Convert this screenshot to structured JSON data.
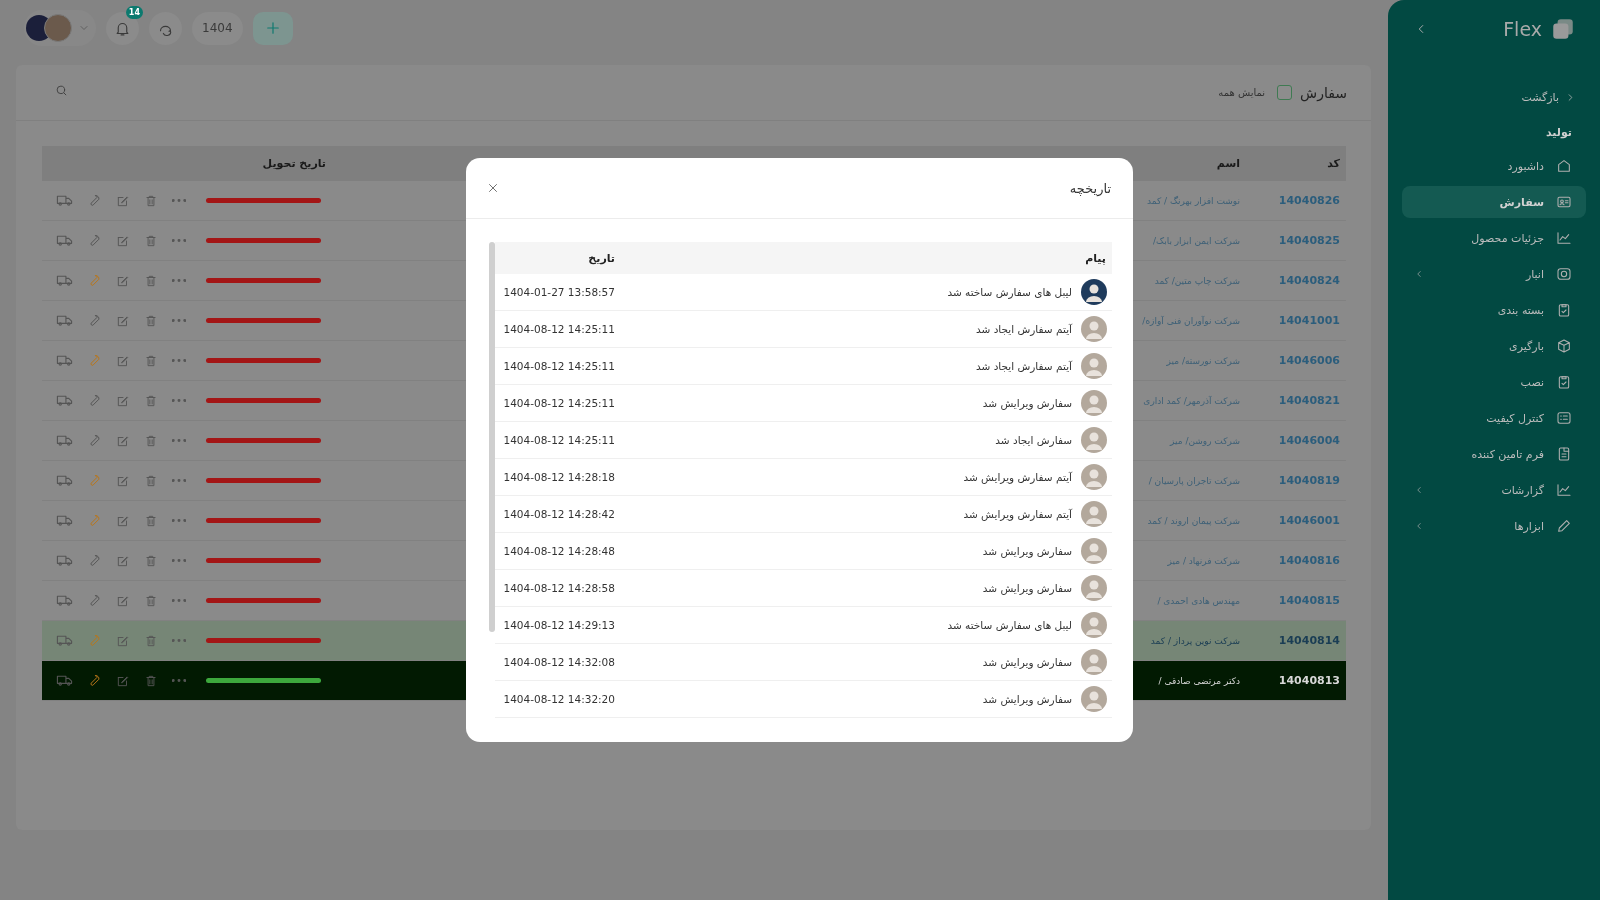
{
  "top_bar": {
    "notifications_badge": "14",
    "year": "1404"
  },
  "page": {
    "title": "سفارش",
    "show_all": {
      "label": "نمایش همه",
      "checked": false
    }
  },
  "table": {
    "columns": [
      "کد",
      "اسم",
      "تاریخ تحویل"
    ],
    "rows": [
      {
        "code": "14040826",
        "name": "نوشت افزار بهرنگ / کمد",
        "color": "#a31616",
        "wrench_highlighted": false,
        "highlighted": false,
        "selected": false
      },
      {
        "code": "14040825",
        "name": "شرکت ایمن ابزار بابک/",
        "color": "#a31616",
        "wrench_highlighted": false,
        "highlighted": false,
        "selected": false
      },
      {
        "code": "14040824",
        "name": "شرکت چاپ متین/ کمد",
        "color": "#a31616",
        "wrench_highlighted": true,
        "highlighted": false,
        "selected": false
      },
      {
        "code": "14041001",
        "name": "شرکت نوآوران فنی آوازه/",
        "color": "#a31616",
        "wrench_highlighted": false,
        "highlighted": false,
        "selected": false
      },
      {
        "code": "14046006",
        "name": "شرکت نورسته/ میز",
        "color": "#a31616",
        "wrench_highlighted": true,
        "highlighted": false,
        "selected": false
      },
      {
        "code": "14040821",
        "name": "شرکت آذرمهر/ کمد اداری",
        "color": "#a31616",
        "wrench_highlighted": false,
        "highlighted": false,
        "selected": false
      },
      {
        "code": "14046004",
        "name": "شرکت روشن/ میز",
        "color": "#a31616",
        "wrench_highlighted": false,
        "highlighted": false,
        "selected": false
      },
      {
        "code": "14040819",
        "name": "شرکت تاجران پارسیان /",
        "color": "#a31616",
        "wrench_highlighted": true,
        "highlighted": false,
        "selected": false
      },
      {
        "code": "14046001",
        "name": "شرکت پیمان اروند / کمد",
        "color": "#a31616",
        "wrench_highlighted": true,
        "highlighted": false,
        "selected": false
      },
      {
        "code": "14040816",
        "name": "شرکت فرنهاد / میز",
        "color": "#a31616",
        "wrench_highlighted": false,
        "highlighted": false,
        "selected": false
      },
      {
        "code": "14040815",
        "name": "مهندس هادی احمدی /",
        "color": "#a31616",
        "wrench_highlighted": false,
        "highlighted": false,
        "selected": false
      },
      {
        "code": "14040814",
        "name": "شرکت نوین پرداز / کمد",
        "color": "#a31616",
        "wrench_highlighted": true,
        "highlighted": true,
        "selected": false
      },
      {
        "code": "14040813",
        "name": "دکتر مرتضی صادقی /",
        "color": "#3da83d",
        "wrench_highlighted": true,
        "highlighted": false,
        "selected": true
      }
    ]
  },
  "modal": {
    "title": "تاریخچه",
    "columns": [
      "پیام",
      "تاریخ"
    ],
    "rows": [
      {
        "message": "لیبل های سفارش ساخته شد",
        "date": "1404-01-27 13:58:57",
        "color": "#1f3b5c"
      },
      {
        "message": "آیتم سفارش ایجاد شد",
        "date": "1404-08-12 14:25:11",
        "color": "#b3a89c"
      },
      {
        "message": "آیتم سفارش ایجاد شد",
        "date": "1404-08-12 14:25:11",
        "color": "#b3a89c"
      },
      {
        "message": "سفارش ویرایش شد",
        "date": "1404-08-12 14:25:11",
        "color": "#b3a89c"
      },
      {
        "message": "سفارش ایجاد شد",
        "date": "1404-08-12 14:25:11",
        "color": "#b3a89c"
      },
      {
        "message": "آیتم سفارش ویرایش شد",
        "date": "1404-08-12 14:28:18",
        "color": "#b3a89c"
      },
      {
        "message": "آیتم سفارش ویرایش شد",
        "date": "1404-08-12 14:28:42",
        "color": "#b3a89c"
      },
      {
        "message": "سفارش ویرایش شد",
        "date": "1404-08-12 14:28:48",
        "color": "#b3a89c"
      },
      {
        "message": "سفارش ویرایش شد",
        "date": "1404-08-12 14:28:58",
        "color": "#b3a89c"
      },
      {
        "message": "لیبل های سفارش ساخته شد",
        "date": "1404-08-12 14:29:13",
        "color": "#b3a89c"
      },
      {
        "message": "سفارش ویرایش شد",
        "date": "1404-08-12 14:32:08",
        "color": "#b3a89c"
      },
      {
        "message": "سفارش ویرایش شد",
        "date": "1404-08-12 14:32:20",
        "color": "#b3a89c"
      }
    ]
  },
  "sidebar": {
    "logo": "Flex",
    "back": "بازگشت",
    "section": "تولید",
    "items": [
      {
        "label": "داشبورد",
        "kind": "link",
        "selected": false
      },
      {
        "label": "سفارش",
        "kind": "link",
        "selected": true
      },
      {
        "label": "جزئیات محصول",
        "kind": "link",
        "selected": false
      },
      {
        "label": "انبار",
        "kind": "group",
        "selected": false
      },
      {
        "label": "بسته بندی",
        "kind": "link",
        "selected": false
      },
      {
        "label": "بارگیری",
        "kind": "link",
        "selected": false
      },
      {
        "label": "نصب",
        "kind": "link",
        "selected": false
      },
      {
        "label": "کنترل کیفیت",
        "kind": "link",
        "selected": false
      },
      {
        "label": "فرم تامین کننده",
        "kind": "link",
        "selected": false
      },
      {
        "label": "گزارشات",
        "kind": "group",
        "selected": false
      },
      {
        "label": "ابزارها",
        "kind": "group",
        "selected": false
      }
    ]
  }
}
